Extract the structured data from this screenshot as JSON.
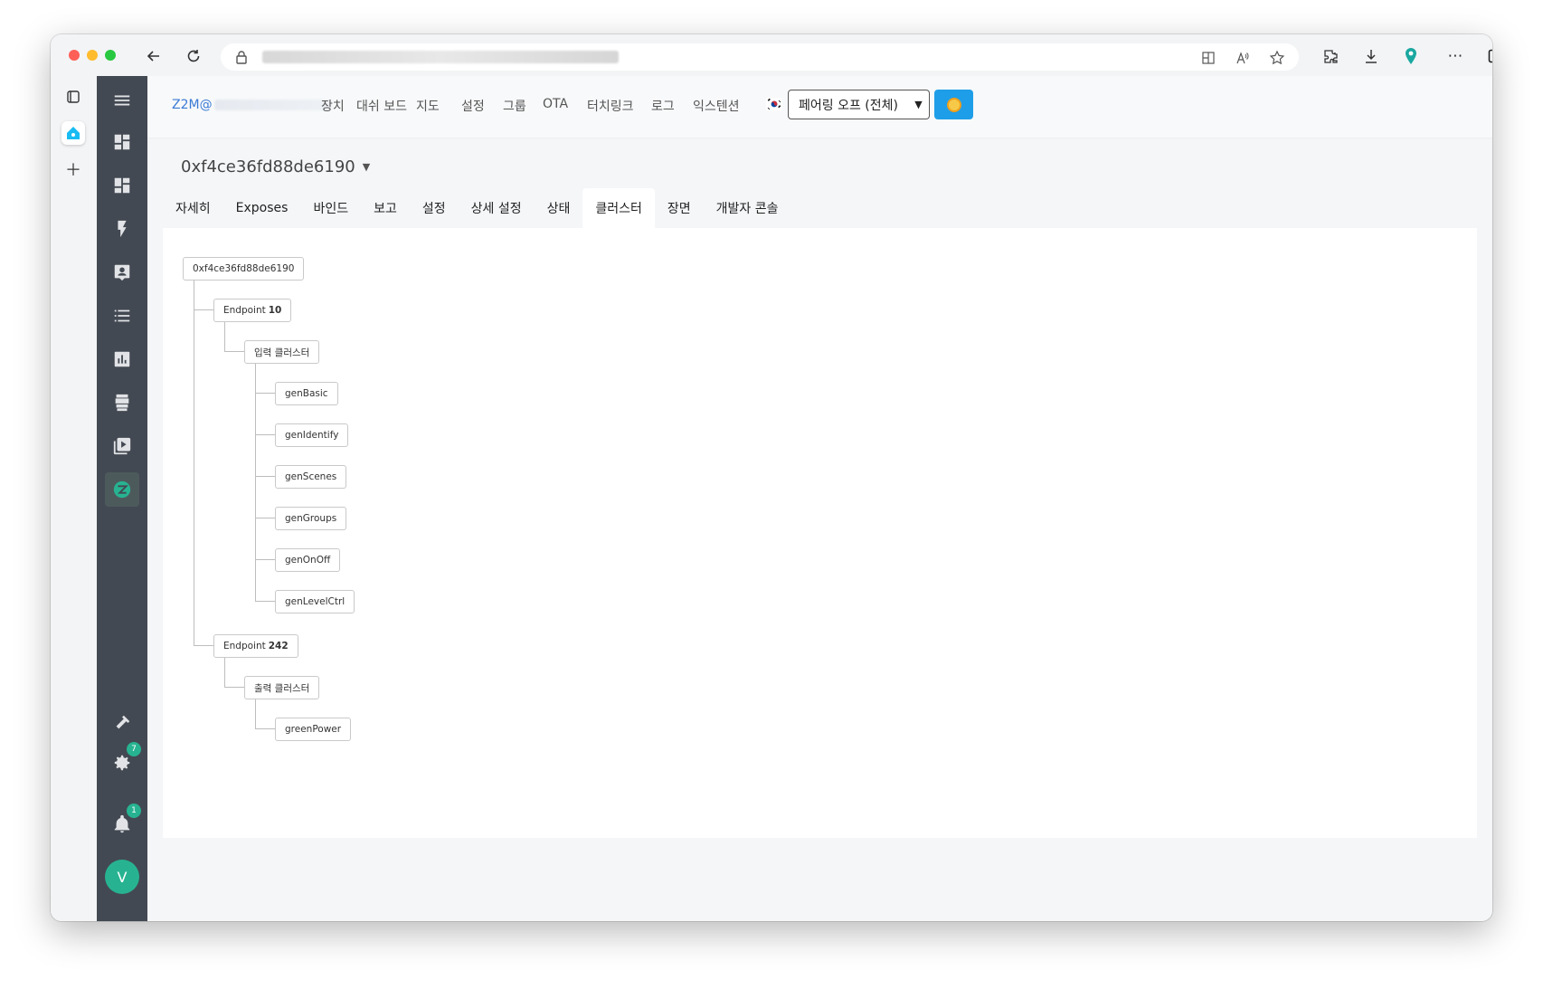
{
  "browser": {
    "icons": [
      "back-icon",
      "reload-icon",
      "lock-icon",
      "split-screen-icon",
      "read-aloud-icon",
      "favorite-icon",
      "extensions-icon",
      "download-icon",
      "pin-icon",
      "more-icon",
      "sidebar-icon"
    ]
  },
  "topnav": {
    "brand": "Z2M@",
    "links": [
      "장치",
      "대쉬 보드",
      "지도",
      "설정",
      "그룹",
      "OTA",
      "터치링크",
      "로그",
      "익스텐션"
    ],
    "pairing_label": "페어링 오프 (전체)"
  },
  "sidebar": {
    "settings_badge": "7",
    "notifications_badge": "1",
    "avatar_initial": "V"
  },
  "device": {
    "title": "0xf4ce36fd88de6190"
  },
  "tabs": [
    "자세히",
    "Exposes",
    "바인드",
    "보고",
    "설정",
    "상세 설정",
    "상태",
    "클러스터",
    "장면",
    "개발자 콘솔"
  ],
  "active_tab_index": 7,
  "tree": {
    "root": "0xf4ce36fd88de6190",
    "endpoint1_prefix": "Endpoint",
    "endpoint1_id": "10",
    "input_group": "입력 클러스터",
    "input_clusters": [
      "genBasic",
      "genIdentify",
      "genScenes",
      "genGroups",
      "genOnOff",
      "genLevelCtrl"
    ],
    "endpoint2_prefix": "Endpoint",
    "endpoint2_id": "242",
    "output_group": "출력 클러스터",
    "output_clusters": [
      "greenPower"
    ]
  }
}
